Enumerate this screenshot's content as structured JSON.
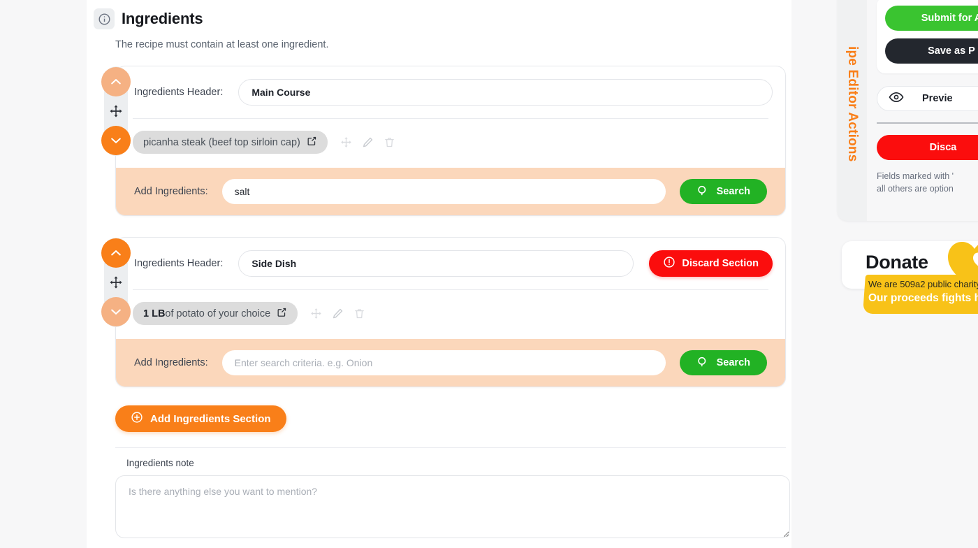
{
  "header": {
    "title": "Ingredients",
    "subtitle": "The recipe must contain at least one ingredient.",
    "info_icon": "info-circle-icon"
  },
  "sections": [
    {
      "label": "Ingredients Header:",
      "header_value": "Main Course",
      "header_placeholder": "",
      "has_discard": false,
      "discard_label": "",
      "up_state": "pale",
      "down_state": "solid",
      "chip": {
        "prefix": "",
        "text": "picanha steak (beef top sirloin cap)",
        "link_icon": "external-link-icon",
        "actions": [
          "move-icon",
          "edit-pencil-icon",
          "trash-icon"
        ]
      },
      "add_label": "Add Ingredients:",
      "search_value": "salt",
      "search_placeholder": "Enter search criteria. e.g. Onion",
      "search_button": "Search"
    },
    {
      "label": "Ingredients Header:",
      "header_value": "Side Dish",
      "header_placeholder": "",
      "has_discard": true,
      "discard_label": "Discard Section",
      "up_state": "solid",
      "down_state": "pale",
      "chip": {
        "prefix": "1 LB",
        "text": " of potato of your choice",
        "link_icon": "external-link-icon",
        "actions": [
          "move-icon",
          "edit-pencil-icon",
          "trash-icon"
        ]
      },
      "add_label": "Add Ingredients:",
      "search_value": "",
      "search_placeholder": "Enter search criteria. e.g. Onion",
      "search_button": "Search"
    }
  ],
  "add_section_button": "Add Ingredients Section",
  "note": {
    "label": "Ingredients note",
    "placeholder": "Is there anything else you want to mention?",
    "value": ""
  },
  "sidebar": {
    "tab_label": "ipe Editor Actions",
    "submit_label": "Submit for A",
    "save_label": "Save as P",
    "preview_label": "Previe",
    "preview_icon": "eye-icon",
    "discard_label": "Disca",
    "note_line1": "Fields marked with '",
    "note_line2": "all others are option"
  },
  "donate": {
    "title": "Donate",
    "line1": "We are 509a2 public charity",
    "line2": "Our proceeds fights h",
    "heart_icon": "heart-icon"
  },
  "colors": {
    "orange": "#f97f19",
    "orange_pale": "#f5b183",
    "green": "#22b224",
    "green_bright": "#3ac430",
    "red": "#fb0d0d",
    "peach": "#fbd7bb",
    "yellow": "#f8c218",
    "dark": "#23272e"
  }
}
